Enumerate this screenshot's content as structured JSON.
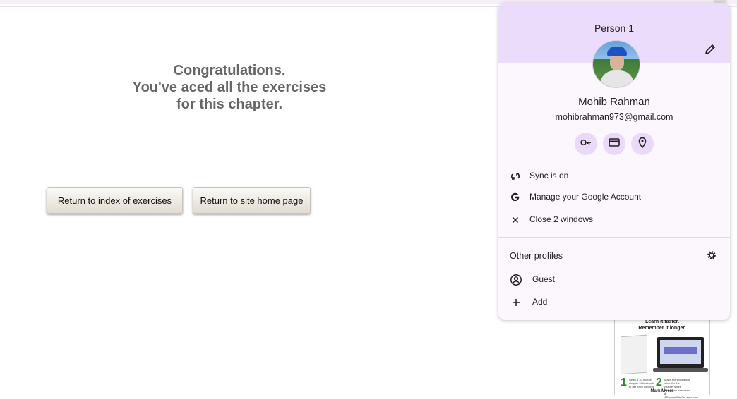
{
  "page": {
    "congrats_lines": [
      "Congratulations.",
      "You've aced all the exercises",
      "for this chapter."
    ],
    "buttons": {
      "return_index": "Return to index of exercises",
      "return_home": "Return to site home page"
    }
  },
  "book_ad": {
    "headline_1": "Learn it faster.",
    "headline_2": "Remember it longer.",
    "step1_number": "1",
    "step1_text": "Read a 10-minute chapter of this book to get each concept.",
    "step2_number": "2",
    "step2_text": "Make the knowledge stick. Do the chapter's free interactive exercises at ASmarterWayToLearn.com.",
    "author": "Mark Myers"
  },
  "profile_popup": {
    "profile_name": "Person 1",
    "user_name": "Mohib Rahman",
    "user_email": "mohibrahman973@gmail.com",
    "quick_icons": [
      "key-icon",
      "credit-card-icon",
      "location-pin-icon"
    ],
    "menu": {
      "sync": "Sync is on",
      "manage": "Manage your Google Account",
      "close": "Close 2 windows"
    },
    "other_profiles_title": "Other profiles",
    "other_profiles": {
      "guest": "Guest",
      "add": "Add"
    },
    "colors": {
      "header": "#ecdcfb",
      "body": "#fcf6fd",
      "icon_circle": "#ebd9fa"
    }
  }
}
